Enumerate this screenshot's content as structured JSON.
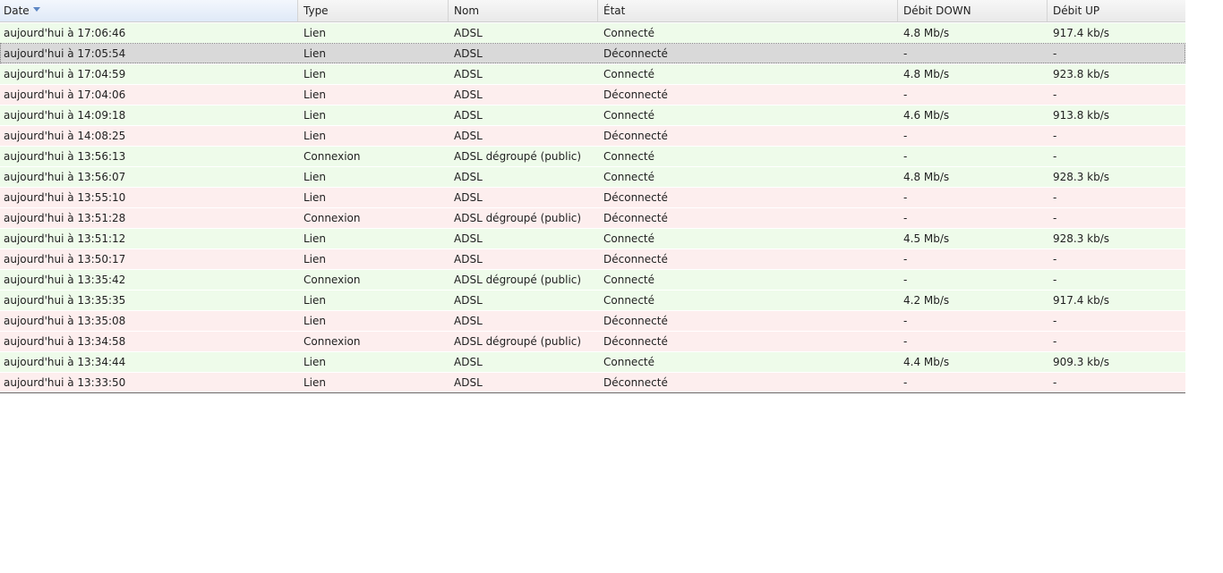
{
  "colors": {
    "row_connected": "#eefbea",
    "row_disconnected": "#fdeeee",
    "row_selected": "#d9d9d9",
    "sort_arrow": "#5d87c4"
  },
  "columns": [
    {
      "key": "date",
      "label": "Date",
      "sorted": "desc"
    },
    {
      "key": "type",
      "label": "Type"
    },
    {
      "key": "nom",
      "label": "Nom"
    },
    {
      "key": "etat",
      "label": "État"
    },
    {
      "key": "down",
      "label": "Débit DOWN"
    },
    {
      "key": "up",
      "label": "Débit UP"
    }
  ],
  "rows": [
    {
      "date": "aujourd'hui à 17:06:46",
      "type": "Lien",
      "nom": "ADSL",
      "etat": "Connecté",
      "down": "4.8 Mb/s",
      "up": "917.4 kb/s",
      "status": "ok"
    },
    {
      "date": "aujourd'hui à 17:05:54",
      "type": "Lien",
      "nom": "ADSL",
      "etat": "Déconnecté",
      "down": "-",
      "up": "-",
      "status": "ko",
      "selected": true
    },
    {
      "date": "aujourd'hui à 17:04:59",
      "type": "Lien",
      "nom": "ADSL",
      "etat": "Connecté",
      "down": "4.8 Mb/s",
      "up": "923.8 kb/s",
      "status": "ok"
    },
    {
      "date": "aujourd'hui à 17:04:06",
      "type": "Lien",
      "nom": "ADSL",
      "etat": "Déconnecté",
      "down": "-",
      "up": "-",
      "status": "ko"
    },
    {
      "date": "aujourd'hui à 14:09:18",
      "type": "Lien",
      "nom": "ADSL",
      "etat": "Connecté",
      "down": "4.6 Mb/s",
      "up": "913.8 kb/s",
      "status": "ok"
    },
    {
      "date": "aujourd'hui à 14:08:25",
      "type": "Lien",
      "nom": "ADSL",
      "etat": "Déconnecté",
      "down": "-",
      "up": "-",
      "status": "ko"
    },
    {
      "date": "aujourd'hui à 13:56:13",
      "type": "Connexion",
      "nom": "ADSL dégroupé (public)",
      "etat": "Connecté",
      "down": "-",
      "up": "-",
      "status": "ok"
    },
    {
      "date": "aujourd'hui à 13:56:07",
      "type": "Lien",
      "nom": "ADSL",
      "etat": "Connecté",
      "down": "4.8 Mb/s",
      "up": "928.3 kb/s",
      "status": "ok"
    },
    {
      "date": "aujourd'hui à 13:55:10",
      "type": "Lien",
      "nom": "ADSL",
      "etat": "Déconnecté",
      "down": "-",
      "up": "-",
      "status": "ko"
    },
    {
      "date": "aujourd'hui à 13:51:28",
      "type": "Connexion",
      "nom": "ADSL dégroupé (public)",
      "etat": "Déconnecté",
      "down": "-",
      "up": "-",
      "status": "ko"
    },
    {
      "date": "aujourd'hui à 13:51:12",
      "type": "Lien",
      "nom": "ADSL",
      "etat": "Connecté",
      "down": "4.5 Mb/s",
      "up": "928.3 kb/s",
      "status": "ok"
    },
    {
      "date": "aujourd'hui à 13:50:17",
      "type": "Lien",
      "nom": "ADSL",
      "etat": "Déconnecté",
      "down": "-",
      "up": "-",
      "status": "ko"
    },
    {
      "date": "aujourd'hui à 13:35:42",
      "type": "Connexion",
      "nom": "ADSL dégroupé (public)",
      "etat": "Connecté",
      "down": "-",
      "up": "-",
      "status": "ok"
    },
    {
      "date": "aujourd'hui à 13:35:35",
      "type": "Lien",
      "nom": "ADSL",
      "etat": "Connecté",
      "down": "4.2 Mb/s",
      "up": "917.4 kb/s",
      "status": "ok"
    },
    {
      "date": "aujourd'hui à 13:35:08",
      "type": "Lien",
      "nom": "ADSL",
      "etat": "Déconnecté",
      "down": "-",
      "up": "-",
      "status": "ko"
    },
    {
      "date": "aujourd'hui à 13:34:58",
      "type": "Connexion",
      "nom": "ADSL dégroupé (public)",
      "etat": "Déconnecté",
      "down": "-",
      "up": "-",
      "status": "ko"
    },
    {
      "date": "aujourd'hui à 13:34:44",
      "type": "Lien",
      "nom": "ADSL",
      "etat": "Connecté",
      "down": "4.4 Mb/s",
      "up": "909.3 kb/s",
      "status": "ok"
    },
    {
      "date": "aujourd'hui à 13:33:50",
      "type": "Lien",
      "nom": "ADSL",
      "etat": "Déconnecté",
      "down": "-",
      "up": "-",
      "status": "ko"
    }
  ]
}
